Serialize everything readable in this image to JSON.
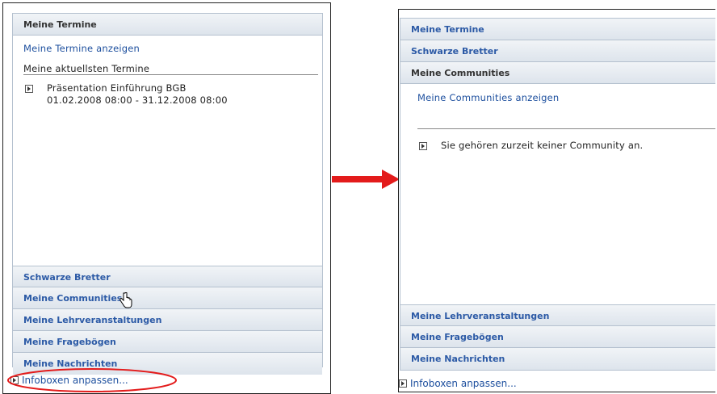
{
  "left": {
    "termine_header": "Meine Termine",
    "termine_link": "Meine Termine anzeigen",
    "termine_subheading": "Meine aktuellsten Termine",
    "event_title": "Präsentation Einführung BGB",
    "event_date": "01.02.2008 08:00 - 31.12.2008 08:00",
    "collapsed": [
      "Schwarze Bretter",
      "Meine Communities",
      "Meine Lehrveranstaltungen",
      "Meine Fragebögen",
      "Meine Nachrichten"
    ],
    "footer_link": "Infoboxen anpassen..."
  },
  "right": {
    "top_headers": [
      "Meine Termine",
      "Schwarze Bretter",
      "Meine Communities"
    ],
    "communities_link": "Meine Communities anzeigen",
    "communities_empty": "Sie gehören zurzeit keiner Community an.",
    "bottom_headers": [
      "Meine Lehrveranstaltungen",
      "Meine Fragebögen",
      "Meine Nachrichten"
    ],
    "footer_link": "Infoboxen anpassen..."
  },
  "colors": {
    "arrow": "#e31b1b",
    "highlight_ellipse": "#e31b1b",
    "link": "#1d4f9e"
  }
}
